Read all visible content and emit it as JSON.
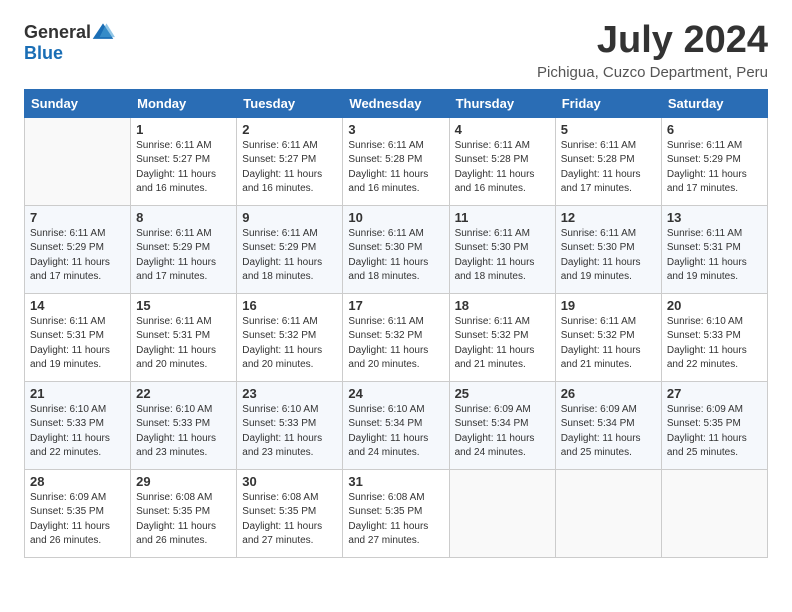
{
  "header": {
    "logo_general": "General",
    "logo_blue": "Blue",
    "month": "July 2024",
    "location": "Pichigua, Cuzco Department, Peru"
  },
  "weekdays": [
    "Sunday",
    "Monday",
    "Tuesday",
    "Wednesday",
    "Thursday",
    "Friday",
    "Saturday"
  ],
  "weeks": [
    [
      {
        "day": "",
        "info": ""
      },
      {
        "day": "1",
        "info": "Sunrise: 6:11 AM\nSunset: 5:27 PM\nDaylight: 11 hours\nand 16 minutes."
      },
      {
        "day": "2",
        "info": "Sunrise: 6:11 AM\nSunset: 5:27 PM\nDaylight: 11 hours\nand 16 minutes."
      },
      {
        "day": "3",
        "info": "Sunrise: 6:11 AM\nSunset: 5:28 PM\nDaylight: 11 hours\nand 16 minutes."
      },
      {
        "day": "4",
        "info": "Sunrise: 6:11 AM\nSunset: 5:28 PM\nDaylight: 11 hours\nand 16 minutes."
      },
      {
        "day": "5",
        "info": "Sunrise: 6:11 AM\nSunset: 5:28 PM\nDaylight: 11 hours\nand 17 minutes."
      },
      {
        "day": "6",
        "info": "Sunrise: 6:11 AM\nSunset: 5:29 PM\nDaylight: 11 hours\nand 17 minutes."
      }
    ],
    [
      {
        "day": "7",
        "info": "Sunrise: 6:11 AM\nSunset: 5:29 PM\nDaylight: 11 hours\nand 17 minutes."
      },
      {
        "day": "8",
        "info": "Sunrise: 6:11 AM\nSunset: 5:29 PM\nDaylight: 11 hours\nand 17 minutes."
      },
      {
        "day": "9",
        "info": "Sunrise: 6:11 AM\nSunset: 5:29 PM\nDaylight: 11 hours\nand 18 minutes."
      },
      {
        "day": "10",
        "info": "Sunrise: 6:11 AM\nSunset: 5:30 PM\nDaylight: 11 hours\nand 18 minutes."
      },
      {
        "day": "11",
        "info": "Sunrise: 6:11 AM\nSunset: 5:30 PM\nDaylight: 11 hours\nand 18 minutes."
      },
      {
        "day": "12",
        "info": "Sunrise: 6:11 AM\nSunset: 5:30 PM\nDaylight: 11 hours\nand 19 minutes."
      },
      {
        "day": "13",
        "info": "Sunrise: 6:11 AM\nSunset: 5:31 PM\nDaylight: 11 hours\nand 19 minutes."
      }
    ],
    [
      {
        "day": "14",
        "info": "Sunrise: 6:11 AM\nSunset: 5:31 PM\nDaylight: 11 hours\nand 19 minutes."
      },
      {
        "day": "15",
        "info": "Sunrise: 6:11 AM\nSunset: 5:31 PM\nDaylight: 11 hours\nand 20 minutes."
      },
      {
        "day": "16",
        "info": "Sunrise: 6:11 AM\nSunset: 5:32 PM\nDaylight: 11 hours\nand 20 minutes."
      },
      {
        "day": "17",
        "info": "Sunrise: 6:11 AM\nSunset: 5:32 PM\nDaylight: 11 hours\nand 20 minutes."
      },
      {
        "day": "18",
        "info": "Sunrise: 6:11 AM\nSunset: 5:32 PM\nDaylight: 11 hours\nand 21 minutes."
      },
      {
        "day": "19",
        "info": "Sunrise: 6:11 AM\nSunset: 5:32 PM\nDaylight: 11 hours\nand 21 minutes."
      },
      {
        "day": "20",
        "info": "Sunrise: 6:10 AM\nSunset: 5:33 PM\nDaylight: 11 hours\nand 22 minutes."
      }
    ],
    [
      {
        "day": "21",
        "info": "Sunrise: 6:10 AM\nSunset: 5:33 PM\nDaylight: 11 hours\nand 22 minutes."
      },
      {
        "day": "22",
        "info": "Sunrise: 6:10 AM\nSunset: 5:33 PM\nDaylight: 11 hours\nand 23 minutes."
      },
      {
        "day": "23",
        "info": "Sunrise: 6:10 AM\nSunset: 5:33 PM\nDaylight: 11 hours\nand 23 minutes."
      },
      {
        "day": "24",
        "info": "Sunrise: 6:10 AM\nSunset: 5:34 PM\nDaylight: 11 hours\nand 24 minutes."
      },
      {
        "day": "25",
        "info": "Sunrise: 6:09 AM\nSunset: 5:34 PM\nDaylight: 11 hours\nand 24 minutes."
      },
      {
        "day": "26",
        "info": "Sunrise: 6:09 AM\nSunset: 5:34 PM\nDaylight: 11 hours\nand 25 minutes."
      },
      {
        "day": "27",
        "info": "Sunrise: 6:09 AM\nSunset: 5:35 PM\nDaylight: 11 hours\nand 25 minutes."
      }
    ],
    [
      {
        "day": "28",
        "info": "Sunrise: 6:09 AM\nSunset: 5:35 PM\nDaylight: 11 hours\nand 26 minutes."
      },
      {
        "day": "29",
        "info": "Sunrise: 6:08 AM\nSunset: 5:35 PM\nDaylight: 11 hours\nand 26 minutes."
      },
      {
        "day": "30",
        "info": "Sunrise: 6:08 AM\nSunset: 5:35 PM\nDaylight: 11 hours\nand 27 minutes."
      },
      {
        "day": "31",
        "info": "Sunrise: 6:08 AM\nSunset: 5:35 PM\nDaylight: 11 hours\nand 27 minutes."
      },
      {
        "day": "",
        "info": ""
      },
      {
        "day": "",
        "info": ""
      },
      {
        "day": "",
        "info": ""
      }
    ]
  ]
}
